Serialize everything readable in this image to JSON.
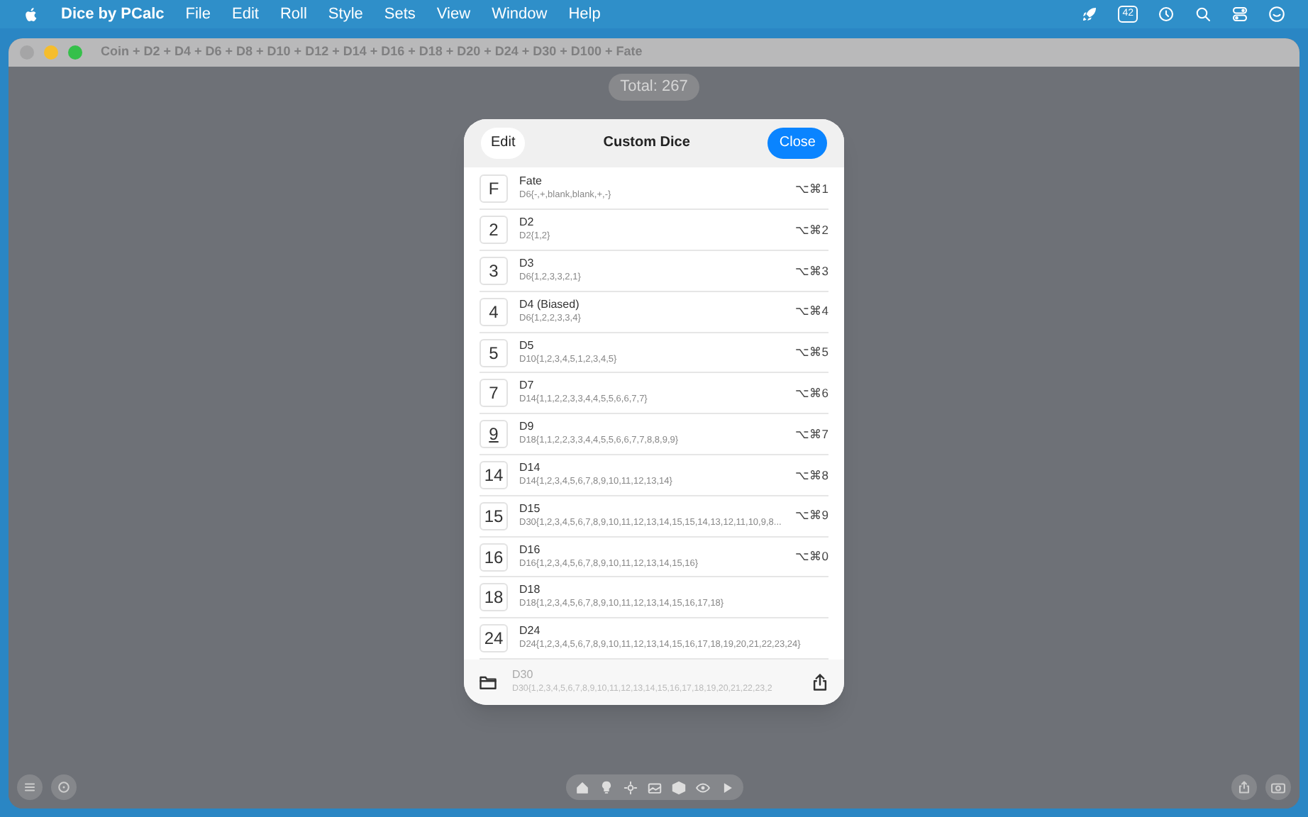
{
  "menu_bar": {
    "app_name": "Dice by PCalc",
    "menus": [
      "File",
      "Edit",
      "Roll",
      "Style",
      "Sets",
      "View",
      "Window",
      "Help"
    ],
    "status_badge": "42"
  },
  "window": {
    "title": "Coin + D2 + D4 + D6 + D8 + D10 + D12 + D14 + D16 + D18 + D20 + D24 + D30 + D100 + Fate",
    "total": "Total: 267"
  },
  "sheet": {
    "edit_button": "Edit",
    "title": "Custom Dice",
    "close_button": "Close",
    "dice": [
      {
        "symbol": "F",
        "name": "Fate",
        "definition": "D6{-,+,blank,blank,+,-}",
        "shortcut": "⌥⌘1",
        "underlined": false
      },
      {
        "symbol": "2",
        "name": "D2",
        "definition": "D2{1,2}",
        "shortcut": "⌥⌘2",
        "underlined": false
      },
      {
        "symbol": "3",
        "name": "D3",
        "definition": "D6{1,2,3,3,2,1}",
        "shortcut": "⌥⌘3",
        "underlined": false
      },
      {
        "symbol": "4",
        "name": "D4 (Biased)",
        "definition": "D6{1,2,2,3,3,4}",
        "shortcut": "⌥⌘4",
        "underlined": false
      },
      {
        "symbol": "5",
        "name": "D5",
        "definition": "D10{1,2,3,4,5,1,2,3,4,5}",
        "shortcut": "⌥⌘5",
        "underlined": false
      },
      {
        "symbol": "7",
        "name": "D7",
        "definition": "D14{1,1,2,2,3,3,4,4,5,5,6,6,7,7}",
        "shortcut": "⌥⌘6",
        "underlined": false
      },
      {
        "symbol": "9",
        "name": "D9",
        "definition": "D18{1,1,2,2,3,3,4,4,5,5,6,6,7,7,8,8,9,9}",
        "shortcut": "⌥⌘7",
        "underlined": true
      },
      {
        "symbol": "14",
        "name": "D14",
        "definition": "D14{1,2,3,4,5,6,7,8,9,10,11,12,13,14}",
        "shortcut": "⌥⌘8",
        "underlined": false
      },
      {
        "symbol": "15",
        "name": "D15",
        "definition": "D30{1,2,3,4,5,6,7,8,9,10,11,12,13,14,15,15,14,13,12,11,10,9,8...",
        "shortcut": "⌥⌘9",
        "underlined": false
      },
      {
        "symbol": "16",
        "name": "D16",
        "definition": "D16{1,2,3,4,5,6,7,8,9,10,11,12,13,14,15,16}",
        "shortcut": "⌥⌘0",
        "underlined": false
      },
      {
        "symbol": "18",
        "name": "D18",
        "definition": "D18{1,2,3,4,5,6,7,8,9,10,11,12,13,14,15,16,17,18}",
        "underlined": false
      },
      {
        "symbol": "24",
        "name": "D24",
        "definition": "D24{1,2,3,4,5,6,7,8,9,10,11,12,13,14,15,16,17,18,19,20,21,22,23,24}",
        "underlined": false
      }
    ],
    "partial_row": {
      "name": "D30",
      "definition": "D30{1,2,3,4,5,6,7,8,9,10,11,12,13,14,15,16,17,18,19,20,21,22,23,2"
    }
  }
}
